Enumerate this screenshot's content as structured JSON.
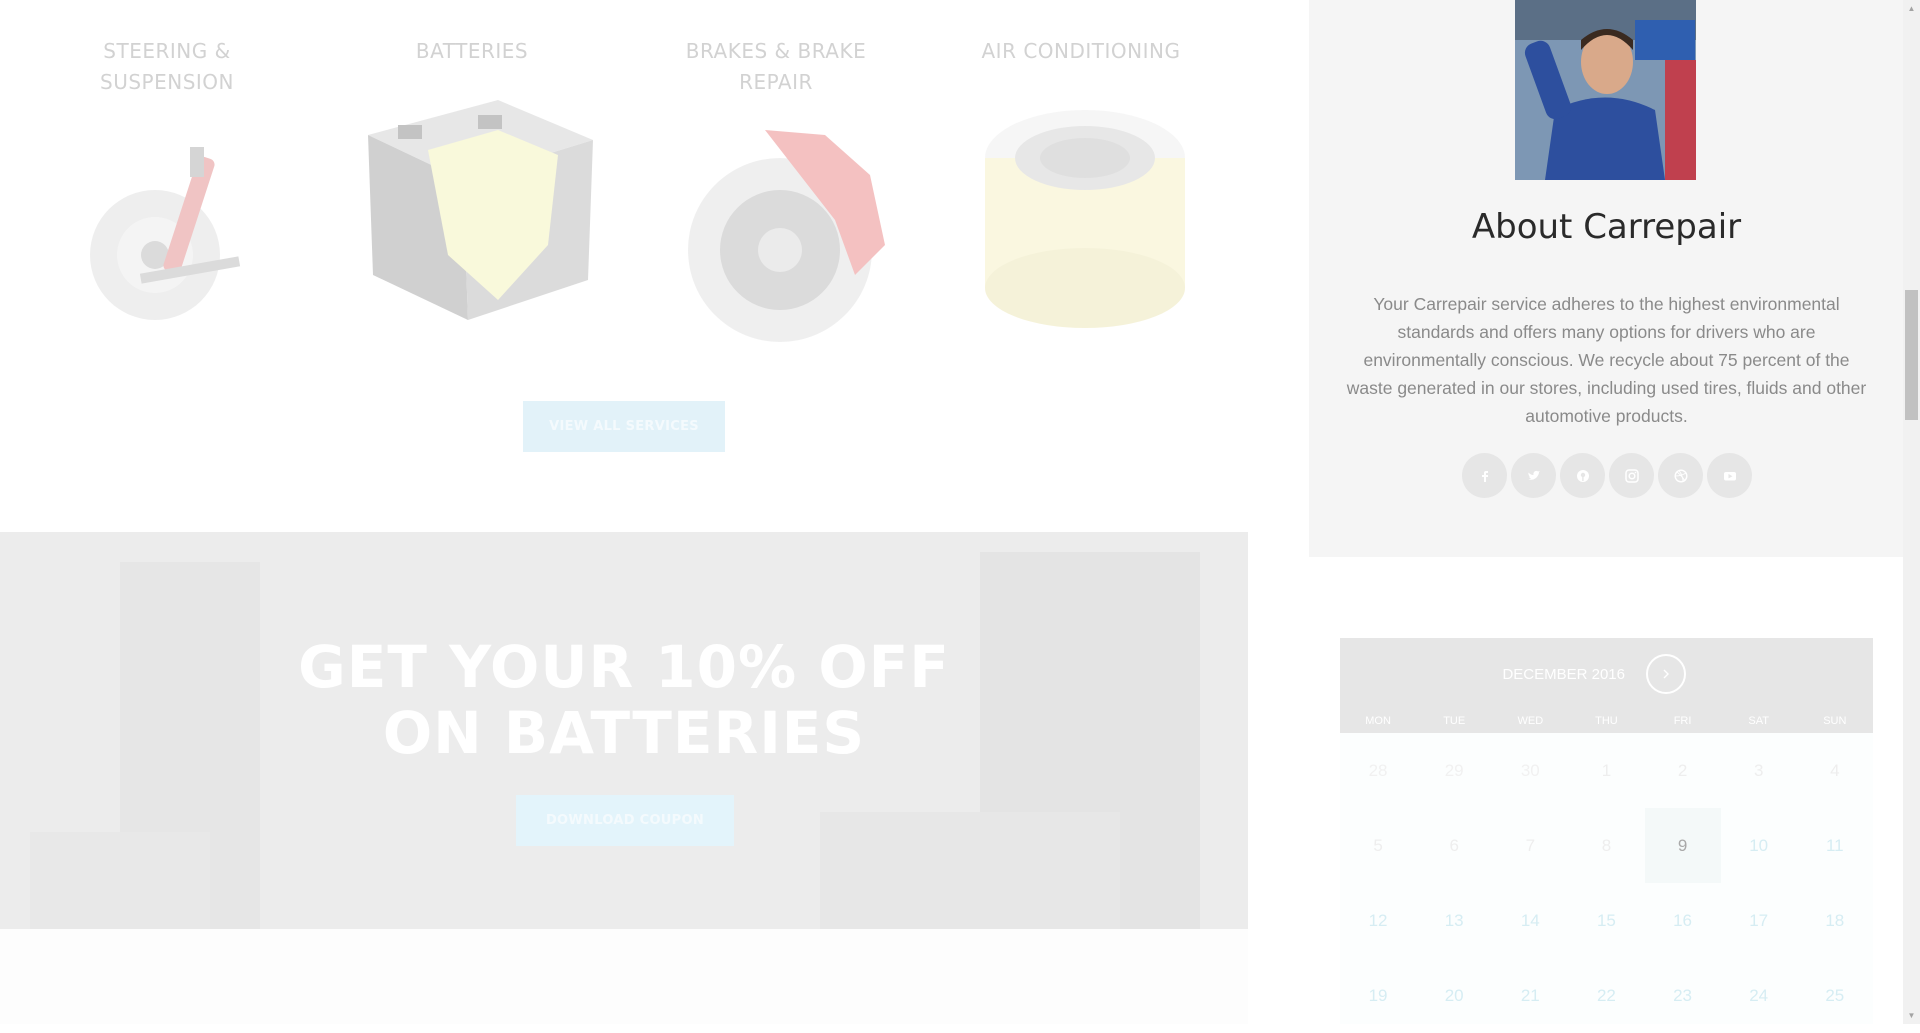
{
  "services": [
    {
      "title": "STEERING & SUSPENSION",
      "icon": "suspension-icon"
    },
    {
      "title": "BATTERIES",
      "icon": "battery-icon"
    },
    {
      "title": "BRAKES & BRAKE REPAIR",
      "icon": "brake-icon"
    },
    {
      "title": "AIR CONDITIONING",
      "icon": "air-filter-icon"
    }
  ],
  "view_all_label": "VIEW ALL SERVICES",
  "promo": {
    "line1": "GET YOUR 10% OFF",
    "line2": "ON BATTERIES",
    "button": "DOWNLOAD COUPON"
  },
  "about": {
    "title": "About Carrepair",
    "text": "Your Carrepair service adheres to the highest environmental standards and offers many options for drivers who are environmentally conscious. We recycle about 75 percent of the waste generated in our stores, including used tires, fluids and other automotive products.",
    "socials": [
      "facebook-icon",
      "twitter-icon",
      "pinterest-icon",
      "instagram-icon",
      "dribbble-icon",
      "youtube-icon"
    ]
  },
  "calendar": {
    "month": "DECEMBER 2016",
    "weekdays": [
      "MON",
      "TUE",
      "WED",
      "THU",
      "FRI",
      "SAT",
      "SUN"
    ],
    "weeks": [
      [
        "28",
        "29",
        "30",
        "1",
        "2",
        "3",
        "4"
      ],
      [
        "5",
        "6",
        "7",
        "8",
        "9",
        "10",
        "11"
      ],
      [
        "12",
        "13",
        "14",
        "15",
        "16",
        "17",
        "18"
      ],
      [
        "19",
        "20",
        "21",
        "22",
        "23",
        "24",
        "25"
      ]
    ],
    "today": "9"
  },
  "colors": {
    "accent_faded": "#e2f2f9",
    "sidebar_bg": "#f5f5f5",
    "calendar_header": "#e6e6e6"
  }
}
